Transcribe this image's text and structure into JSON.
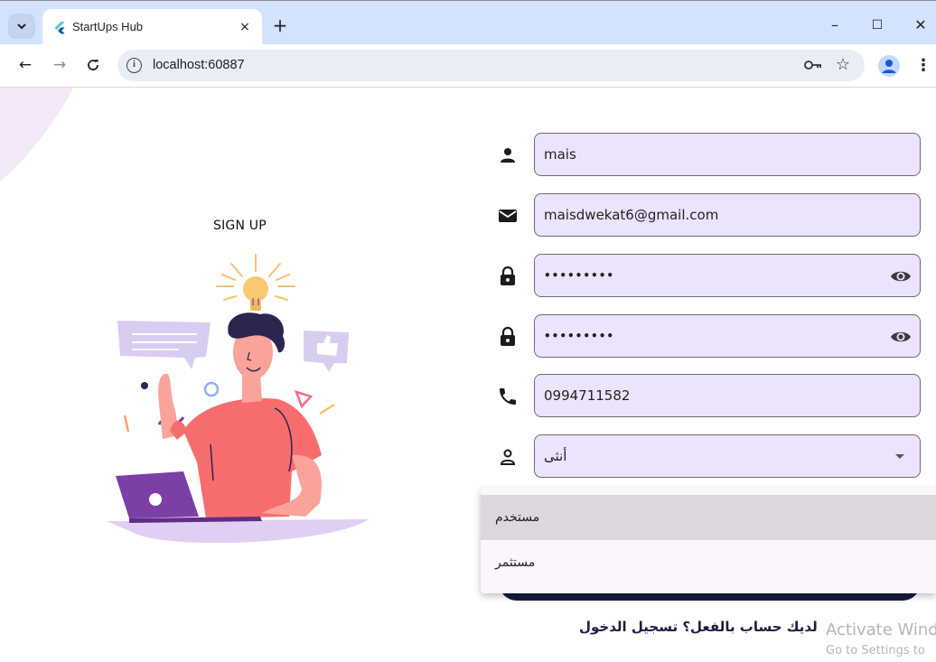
{
  "browser": {
    "tab_title": "StartUps Hub",
    "tab_close": "×",
    "new_tab": "+",
    "url": "localhost:60887",
    "window_controls": {
      "minimize": "–",
      "maximize": "☐",
      "close": "✕"
    },
    "nav": {
      "back": "←",
      "forward": "→",
      "reload": "C"
    },
    "icons": [
      "tab-search-icon",
      "flutter-icon",
      "info-icon",
      "password-key-icon",
      "bookmark-star-icon",
      "profile-icon",
      "menu-dots-icon"
    ]
  },
  "page": {
    "title": "SIGN UP",
    "fields": [
      {
        "icon": "person-icon",
        "value": "mais"
      },
      {
        "icon": "mail-icon",
        "value": "maisdwekat6@gmail.com"
      },
      {
        "icon": "lock-icon",
        "value": "•••••••••",
        "toggle_icon": "eye-icon"
      },
      {
        "icon": "lock-icon",
        "value": "•••••••••",
        "toggle_icon": "eye-icon"
      },
      {
        "icon": "phone-icon",
        "value": "0994711582"
      },
      {
        "icon": "person-outline-icon",
        "value": "أنثى",
        "dropdown_icon": "caret-down-icon"
      }
    ],
    "dropdown_options": [
      {
        "label": "مستخدم",
        "highlighted": true
      },
      {
        "label": "مستثمر",
        "highlighted": false
      }
    ],
    "login_link": "لديك حساب بالفعل؟ تسجيل الدخول",
    "colors": {
      "field_fill": "#ece3fc",
      "button": "#161b3e",
      "accent_purple": "#7b3fa6",
      "shirt": "#f76d6d"
    }
  },
  "watermark": {
    "line1": "Activate Windo",
    "line2": "Go to Settings to"
  }
}
